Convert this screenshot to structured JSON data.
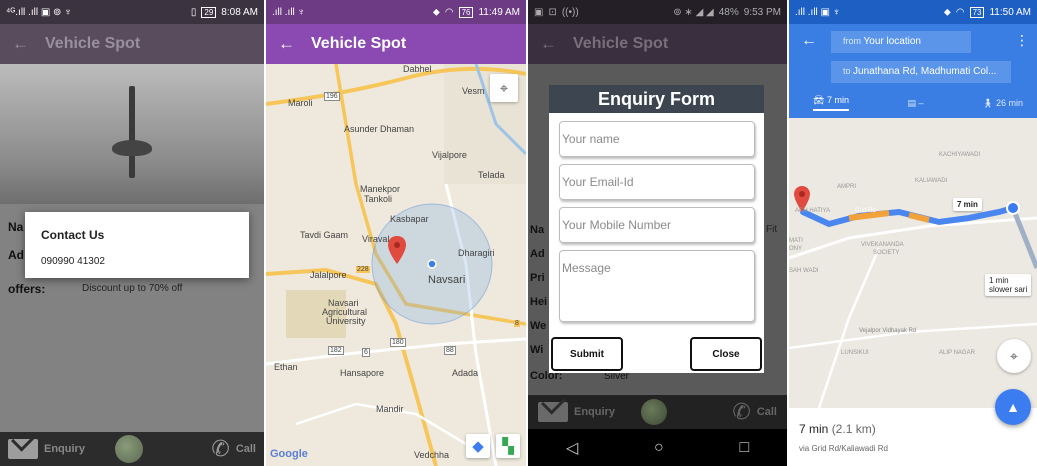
{
  "screen1": {
    "status_left": "⁴ᴳ.ıll .ıll ▣ ⊚ ♆",
    "status_time": "8:08 AM",
    "status_battery": "29",
    "title": "Vehicle Spot",
    "rows": {
      "name_label": "Na",
      "address_label": "Ad",
      "offers_label": "offers:"
    },
    "offers_value": "Discount up to 70% off",
    "dialog": {
      "title": "Contact Us",
      "phone": "090990 41302"
    },
    "bottom": {
      "enquiry": "Enquiry",
      "call": "Call"
    }
  },
  "screen2": {
    "status_left": ".ıll .ıll ♆",
    "status_time": "11:49 AM",
    "status_battery": "76",
    "title": "Vehicle Spot",
    "places": {
      "dabhel": "Dabhel",
      "vesma": "Vesm",
      "maroli": "Maroli",
      "asunder": "Asunder Dhaman",
      "vijalpore": "Vijalpore",
      "telada": "Telada",
      "manekpor": "Manekpor",
      "tankoli": "Tankoli",
      "kasbapar": "Kasbapar",
      "tavdi": "Tavdi Gaam",
      "viraval": "Viraval",
      "dharagiri": "Dharagiri",
      "jalalpore": "Jalalpore",
      "navsari": "Navsari",
      "navsari_uni1": "Navsari",
      "navsari_uni2": "Agricultural",
      "navsari_uni3": "University",
      "ethan": "Ethan",
      "hansapore": "Hansapore",
      "adada": "Adada",
      "mandir": "Mandir",
      "vedchha": "Vedchha"
    },
    "roads": {
      "r196": "196",
      "r228": "228",
      "r182": "182",
      "r6": "6",
      "r180": "180",
      "r88": "88",
      "r8": "8"
    },
    "logo": "Google"
  },
  "screen3": {
    "status_time": "9:53 PM",
    "status_battery": "48%",
    "title": "Vehicle Spot",
    "form": {
      "title": "Enquiry Form",
      "name_placeholder": "Your name",
      "email_placeholder": "Your Email-Id",
      "mobile_placeholder": "Your Mobile Number",
      "message_placeholder": "Message",
      "submit": "Submit",
      "close": "Close"
    },
    "bg_rows": {
      "na": "Na",
      "ad": "Ad",
      "pri": "Pri",
      "hei": "Hei",
      "we": "We",
      "wi": "Wi",
      "color_label": "Color:",
      "color_value": "Silver",
      "fit": "Fit"
    },
    "bottom": {
      "enquiry": "Enquiry",
      "call": "Call"
    }
  },
  "screen4": {
    "status_left": ".ıll .ıll ▣ ♆",
    "status_time": "11:50 AM",
    "status_battery": "73",
    "from_prefix": "from",
    "from": "Your location",
    "to_prefix": "to",
    "to": "Junathana Rd, Madhumati Col...",
    "modes": {
      "car": "7 min",
      "transit": "–",
      "walk": "26 min"
    },
    "map_labels": {
      "kachiyawadi": "KACHIYAWADI",
      "kaliawadi": "KALIAWADI",
      "ampri": "AMPRI",
      "ach_hatiya": "ACH HATIYA",
      "mati": "MATI",
      "colony": "ONY",
      "vivekananda": "VIVEKANANDA",
      "society": "SOCIETY",
      "sah_wadi": "SAH WADI",
      "vejalpor": "Vejalpor Vidhayak Rd",
      "lunsikui": "LUNSIKUI",
      "alip_nagar": "ALIP NAGAR",
      "grid_road": "Grid Rd"
    },
    "callout_main": "7 min",
    "callout_alt_1": "1 min",
    "callout_alt_2": "slower",
    "callout_alt_3": "sari",
    "eta": "7 min",
    "distance": "(2.1 km)",
    "via": "via Grid Rd/Kaliawadi Rd",
    "colors": {
      "route": "#4a86ef",
      "route_alt": "#9fb0c6",
      "traffic": "#f2a23a"
    }
  }
}
